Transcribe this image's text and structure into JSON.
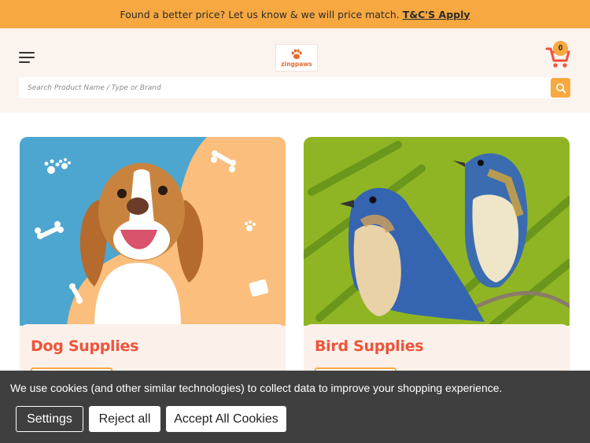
{
  "promo_bar": {
    "message": "Found a better price? Let us know & we will price match.",
    "link_label": "T&C'S Apply",
    "background": "#f7a840"
  },
  "header": {
    "menu_icon": "hamburger-menu-icon",
    "logo_text": "zingpaws",
    "logo_icon": "paw-icon",
    "cart_icon": "shopping-cart-icon",
    "cart_count": "0",
    "background": "#fbf3ee"
  },
  "search": {
    "placeholder": "Search Product Name / Type or Brand",
    "button_icon": "search-icon",
    "button_color": "#f7a840"
  },
  "categories": [
    {
      "title": "Dog Supplies",
      "image": "beagle-dog-photo",
      "title_color": "#f0533b"
    },
    {
      "title": "Bird Supplies",
      "image": "bluebirds-photo",
      "title_color": "#f0533b"
    }
  ],
  "cookie_banner": {
    "message": "We use cookies (and other similar technologies) to collect data to improve your shopping experience.",
    "settings_label": "Settings",
    "reject_label": "Reject all",
    "accept_label": "Accept All Cookies"
  }
}
